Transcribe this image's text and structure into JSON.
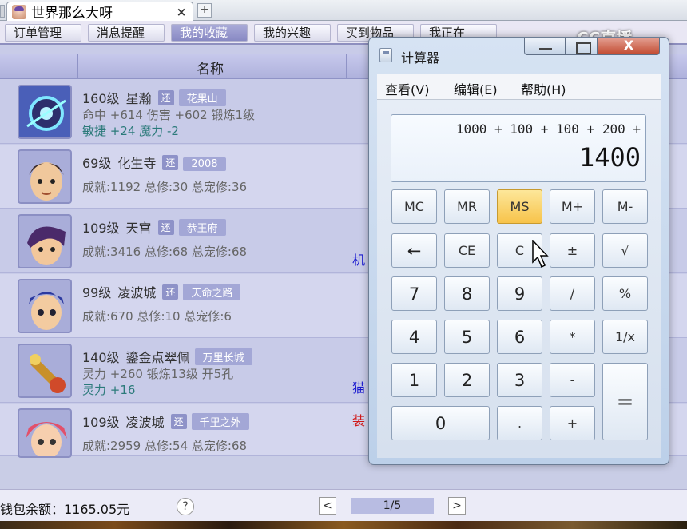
{
  "browser": {
    "tab_title": "世界那么大呀",
    "close_label": "×",
    "new_tab_label": "+"
  },
  "nav": {
    "items": [
      "订单管理",
      "消息提醒",
      "我的收藏",
      "我的兴趣",
      "买到物品",
      "我正在"
    ],
    "active_index": 2
  },
  "list": {
    "column_name": "名称",
    "rows": [
      {
        "level": "160级",
        "name": "星瀚",
        "badge": "还",
        "server": "花果山",
        "line2": "命中 +614 伤害 +602 锻炼1级",
        "line3": "敏捷 +24 魔力 -2",
        "side": ""
      },
      {
        "level": "69级",
        "name": "化生寺",
        "badge": "还",
        "server": "2008",
        "line2": "成就:1192 总修:30 总宠修:36",
        "line3": "",
        "side": ""
      },
      {
        "level": "109级",
        "name": "天宫",
        "badge": "还",
        "server": "恭王府",
        "line2": "成就:3416 总修:68 总宠修:68",
        "line3": "",
        "side": "机"
      },
      {
        "level": "99级",
        "name": "凌波城",
        "badge": "还",
        "server": "天命之路",
        "line2": "成就:670 总修:10 总宠修:6",
        "line3": "",
        "side": ""
      },
      {
        "level": "140级",
        "name": "鎏金点翠佩",
        "badge": "",
        "server": "万里长城",
        "line2": "灵力 +260 锻炼13级 开5孔",
        "line3": "灵力 +16",
        "side": "猫"
      },
      {
        "level": "109级",
        "name": "凌波城",
        "badge": "还",
        "server": "千里之外",
        "line2": "成就:2959 总修:54 总宠修:68",
        "line3": "",
        "side": "装"
      }
    ]
  },
  "footer": {
    "wallet": "钱包余额：1165.05元",
    "help": "?",
    "prev": "<",
    "next": ">",
    "page": "1/5"
  },
  "watermark": "CC直播",
  "calculator": {
    "title": "计算器",
    "close_label": "X",
    "menus": [
      {
        "label": "查看(V)"
      },
      {
        "label": "编辑(E)"
      },
      {
        "label": "帮助(H)"
      }
    ],
    "expression": "1000 + 100 + 100 + 200 +",
    "result": "1400",
    "keys": [
      "MC",
      "MR",
      "MS",
      "M+",
      "M-",
      "←",
      "CE",
      "C",
      "±",
      "√",
      "7",
      "8",
      "9",
      "/",
      "%",
      "4",
      "5",
      "6",
      "*",
      "1/x",
      "1",
      "2",
      "3",
      "-",
      "=",
      "0",
      ".",
      "+"
    ],
    "highlighted_key": "MS"
  }
}
